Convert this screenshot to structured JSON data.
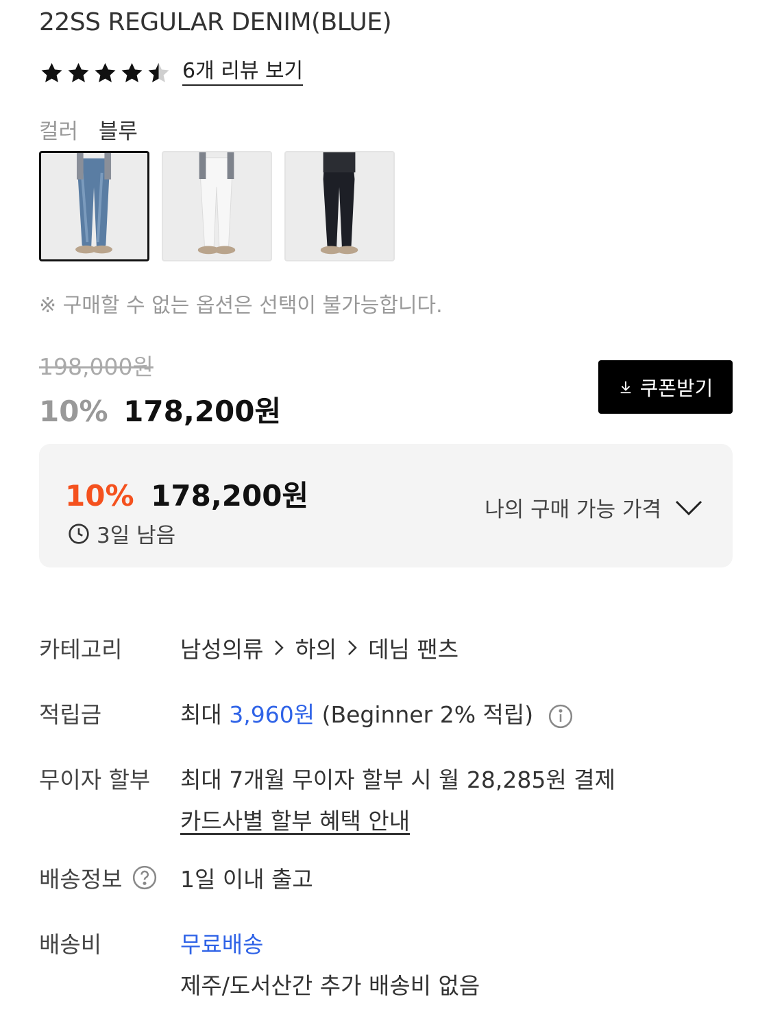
{
  "product": {
    "title": "22SS REGULAR DENIM(BLUE)",
    "rating_stars": 4.5,
    "review_link": "6개 리뷰 보기"
  },
  "color": {
    "label": "컬러",
    "value": "블루",
    "options": [
      {
        "name": "blue-jeans",
        "selected": true,
        "tone": "#5a7da3"
      },
      {
        "name": "white-jeans",
        "selected": false,
        "tone": "#f2f2f2"
      },
      {
        "name": "black-jeans",
        "selected": false,
        "tone": "#1d1f26"
      }
    ]
  },
  "notice": "※ 구매할 수 없는 옵션은 선택이 불가능합니다.",
  "price": {
    "original": "198,000원",
    "discount_pct": "10%",
    "sale": "178,200원",
    "coupon_button": "쿠폰받기"
  },
  "my_price": {
    "discount_pct": "10%",
    "amount": "178,200원",
    "remaining": "3일 남음",
    "toggle_label": "나의 구매 가능 가격"
  },
  "info": {
    "category": {
      "label": "카테고리",
      "path": [
        "남성의류",
        "하의",
        "데님 팬츠"
      ]
    },
    "points": {
      "label": "적립금",
      "prefix": "최대",
      "amount": "3,960원",
      "suffix": "(Beginner 2% 적립)"
    },
    "installment": {
      "label": "무이자 할부",
      "text": "최대 7개월 무이자 할부 시 월 28,285원 결제",
      "link": "카드사별 할부 혜택 안내"
    },
    "delivery_info": {
      "label": "배송정보",
      "value": "1일 이내 출고"
    },
    "shipping_fee": {
      "label": "배송비",
      "value": "무료배송",
      "note": "제주/도서산간 추가 배송비 없음"
    }
  },
  "colors": {
    "accent_orange": "#f4511e",
    "link_blue": "#2f63e7",
    "button_black": "#000000",
    "panel_gray": "#f4f4f4"
  }
}
